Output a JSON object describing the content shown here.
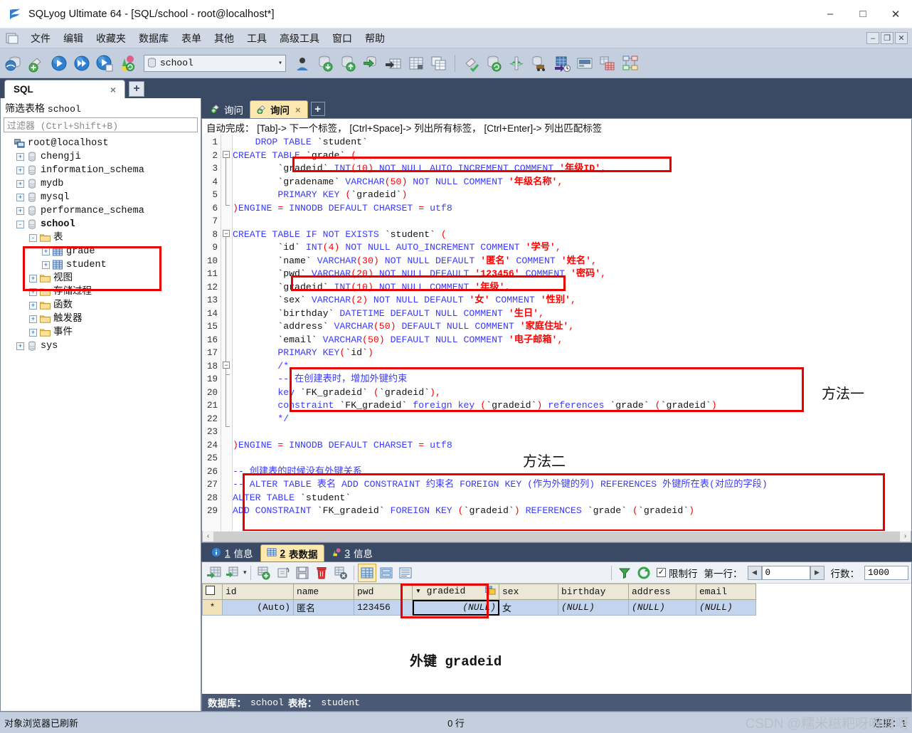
{
  "window": {
    "title": "SQLyog Ultimate 64 - [SQL/school - root@localhost*]",
    "icon": "sqlyog-logo-icon",
    "minimize": "–",
    "maximize": "□",
    "close": "✕",
    "mdi_minimize": "–",
    "mdi_restore": "❐",
    "mdi_close": "✕"
  },
  "menubar": {
    "items": [
      {
        "label": "文件",
        "name": "menu-file"
      },
      {
        "label": "编辑",
        "name": "menu-edit"
      },
      {
        "label": "收藏夹",
        "name": "menu-favorites"
      },
      {
        "label": "数据库",
        "name": "menu-database"
      },
      {
        "label": "表单",
        "name": "menu-table"
      },
      {
        "label": "其他",
        "name": "menu-other"
      },
      {
        "label": "工具",
        "name": "menu-tools"
      },
      {
        "label": "高级工具",
        "name": "menu-advanced-tools"
      },
      {
        "label": "窗口",
        "name": "menu-window"
      },
      {
        "label": "帮助",
        "name": "menu-help"
      }
    ]
  },
  "toolbar": {
    "db_selector_value": "school",
    "db_selector_caret": "⌄",
    "icons": [
      "new-connection-icon",
      "new-connection-add-icon",
      "execute-query-icon",
      "execute-all-queries-icon",
      "execute-query-to-new-tab-icon",
      "refresh-objects-icon",
      "user-manager-icon",
      "import-database-icon",
      "export-database-icon",
      "backup-database-icon",
      "import-external-data-icon",
      "table-data-icon",
      "copy-database-icon",
      "flush-icon",
      "sync-database-icon",
      "compare-data-icon",
      "migration-icon",
      "scheduled-backup-icon",
      "notification-services-icon",
      "table-diagnostics-icon",
      "schema-designer-icon"
    ]
  },
  "outer_tabs": {
    "tabs": [
      {
        "label": "SQL",
        "close": "×",
        "active": true
      }
    ],
    "add_label": "+"
  },
  "object_browser": {
    "title_prefix": "筛选表格",
    "title_value": "school",
    "filter_placeholder": "过滤器 (Ctrl+Shift+B)",
    "tree": [
      {
        "label": "root@localhost",
        "level": 0,
        "icon": "host-icon",
        "expander": "",
        "bold": false
      },
      {
        "label": "chengji",
        "level": 1,
        "icon": "database-icon",
        "expander": "+",
        "bold": false
      },
      {
        "label": "information_schema",
        "level": 1,
        "icon": "database-icon",
        "expander": "+",
        "bold": false
      },
      {
        "label": "mydb",
        "level": 1,
        "icon": "database-icon",
        "expander": "+",
        "bold": false
      },
      {
        "label": "mysql",
        "level": 1,
        "icon": "database-icon",
        "expander": "+",
        "bold": false
      },
      {
        "label": "performance_schema",
        "level": 1,
        "icon": "database-icon",
        "expander": "+",
        "bold": false
      },
      {
        "label": "school",
        "level": 1,
        "icon": "database-icon",
        "expander": "-",
        "bold": true
      },
      {
        "label": "表",
        "level": 2,
        "icon": "folder-icon",
        "expander": "-",
        "bold": false
      },
      {
        "label": "grade",
        "level": 3,
        "icon": "table-icon",
        "expander": "+",
        "bold": false
      },
      {
        "label": "student",
        "level": 3,
        "icon": "table-icon",
        "expander": "+",
        "bold": false
      },
      {
        "label": "视图",
        "level": 2,
        "icon": "folder-icon",
        "expander": "+",
        "bold": false
      },
      {
        "label": "存储过程",
        "level": 2,
        "icon": "folder-icon",
        "expander": "+",
        "bold": false
      },
      {
        "label": "函数",
        "level": 2,
        "icon": "folder-icon",
        "expander": "+",
        "bold": false
      },
      {
        "label": "触发器",
        "level": 2,
        "icon": "folder-icon",
        "expander": "+",
        "bold": false
      },
      {
        "label": "事件",
        "level": 2,
        "icon": "folder-icon",
        "expander": "+",
        "bold": false
      },
      {
        "label": "sys",
        "level": 1,
        "icon": "database-icon",
        "expander": "+",
        "bold": false
      }
    ]
  },
  "query_tabs": {
    "tabs": [
      {
        "label": "询问",
        "active": false,
        "icon": "query-icon"
      },
      {
        "label": "询问",
        "active": true,
        "icon": "query-icon",
        "close": "×"
      }
    ],
    "add_label": "+"
  },
  "editor": {
    "hint": "自动完成： [Tab]-> 下一个标签， [Ctrl+Space]-> 列出所有标签， [Ctrl+Enter]-> 列出匹配标签",
    "lines": [
      {
        "n": 1,
        "text": "    DROP TABLE `student`"
      },
      {
        "n": 2,
        "text": "CREATE TABLE `grade` ("
      },
      {
        "n": 3,
        "text": "        `gradeid` INT(10) NOT NULL AUTO_INCREMENT COMMENT '年级ID',"
      },
      {
        "n": 4,
        "text": "        `gradename` VARCHAR(50) NOT NULL COMMENT '年级名称',"
      },
      {
        "n": 5,
        "text": "        PRIMARY KEY (`gradeid`)"
      },
      {
        "n": 6,
        "text": ")ENGINE = INNODB DEFAULT CHARSET = utf8"
      },
      {
        "n": 7,
        "text": ""
      },
      {
        "n": 8,
        "text": "CREATE TABLE IF NOT EXISTS `student` ("
      },
      {
        "n": 9,
        "text": "        `id` INT(4) NOT NULL AUTO_INCREMENT COMMENT '学号',"
      },
      {
        "n": 10,
        "text": "        `name` VARCHAR(30) NOT NULL DEFAULT '匿名' COMMENT '姓名',"
      },
      {
        "n": 11,
        "text": "        `pwd` VARCHAR(20) NOT NULL DEFAULT '123456' COMMENT '密码',"
      },
      {
        "n": 12,
        "text": "        `gradeid` INT(10) NOT NULL COMMENT '年级',"
      },
      {
        "n": 13,
        "text": "        `sex` VARCHAR(2) NOT NULL DEFAULT '女' COMMENT '性别',"
      },
      {
        "n": 14,
        "text": "        `birthday` DATETIME DEFAULT NULL COMMENT '生日',"
      },
      {
        "n": 15,
        "text": "        `address` VARCHAR(50) DEFAULT NULL COMMENT '家庭住址',"
      },
      {
        "n": 16,
        "text": "        `email` VARCHAR(50) DEFAULT NULL COMMENT '电子邮箱',"
      },
      {
        "n": 17,
        "text": "        PRIMARY KEY(`id`)"
      },
      {
        "n": 18,
        "text": "        /*"
      },
      {
        "n": 19,
        "text": "        -- 在创建表时，增加外键约束"
      },
      {
        "n": 20,
        "text": "        key `FK_gradeid` (`gradeid`),"
      },
      {
        "n": 21,
        "text": "        constraint `FK_gradeid` foreign key (`gradeid`) references `grade` (`gradeid`)"
      },
      {
        "n": 22,
        "text": "        */"
      },
      {
        "n": 23,
        "text": ""
      },
      {
        "n": 24,
        "text": ")ENGINE = INNODB DEFAULT CHARSET = utf8"
      },
      {
        "n": 25,
        "text": ""
      },
      {
        "n": 26,
        "text": "-- 创建表的时候没有外键关系"
      },
      {
        "n": 27,
        "text": "-- ALTER TABLE 表名 ADD CONSTRAINT 约束名 FOREIGN KEY (作为外键的列) REFERENCES 外键所在表(对应的字段)"
      },
      {
        "n": 28,
        "text": "ALTER TABLE `student`"
      },
      {
        "n": 29,
        "text": "ADD CONSTRAINT `FK_gradeid` FOREIGN KEY (`gradeid`) REFERENCES `grade` (`gradeid`)"
      }
    ],
    "scroll_left": "‹",
    "scroll_right": "›"
  },
  "annotations": {
    "method_one": "方法一",
    "method_two": "方法二",
    "foreign_key_caption": "外键 gradeid",
    "highlight_color": "#e60000"
  },
  "result_tabs": {
    "tabs": [
      {
        "num": "1",
        "label": "信息",
        "active": false,
        "icon": "info-icon"
      },
      {
        "num": "2",
        "label": "表数据",
        "active": true,
        "icon": "table-data-icon"
      },
      {
        "num": "3",
        "label": "信息",
        "active": false,
        "icon": "profile-icon"
      }
    ]
  },
  "grid_toolbar": {
    "icons": [
      "refresh-data-icon",
      "refresh-dropdown-icon",
      "insert-row-icon",
      "clone-row-icon",
      "save-changes-icon",
      "delete-row-icon",
      "discard-changes-icon",
      "grid-view-icon",
      "form-view-icon",
      "text-view-icon",
      "filter-icon",
      "reload-icon"
    ],
    "dropdown_caret": "▾",
    "limit_checkbox": "☑",
    "limit_label": "限制行",
    "first_row_label": "第一行：",
    "first_row_value": "0",
    "prev_arrow": "◀",
    "next_arrow": "▶",
    "rows_label": "行数：",
    "rows_value": "1000"
  },
  "grid": {
    "columns": [
      "id",
      "name",
      "pwd",
      "gradeid",
      "sex",
      "birthday",
      "address",
      "email"
    ],
    "sorted_column": "gradeid",
    "sort_caret": "▾",
    "rows": [
      {
        "marker": "*",
        "cells": [
          "(Auto)",
          "匿名",
          "123456",
          "(NULL)",
          "女",
          "(NULL)",
          "(NULL)",
          "(NULL)"
        ]
      }
    ]
  },
  "db_status": {
    "db_label": "数据库：",
    "db_value": "school",
    "table_label": "表格：",
    "table_value": "student"
  },
  "statusbar": {
    "left": "对象浏览器已刷新",
    "middle": "0 行",
    "right_label": "连接：",
    "right_value": "1",
    "watermark": "CSDN @糯米糍粑呀呀呀呀"
  }
}
